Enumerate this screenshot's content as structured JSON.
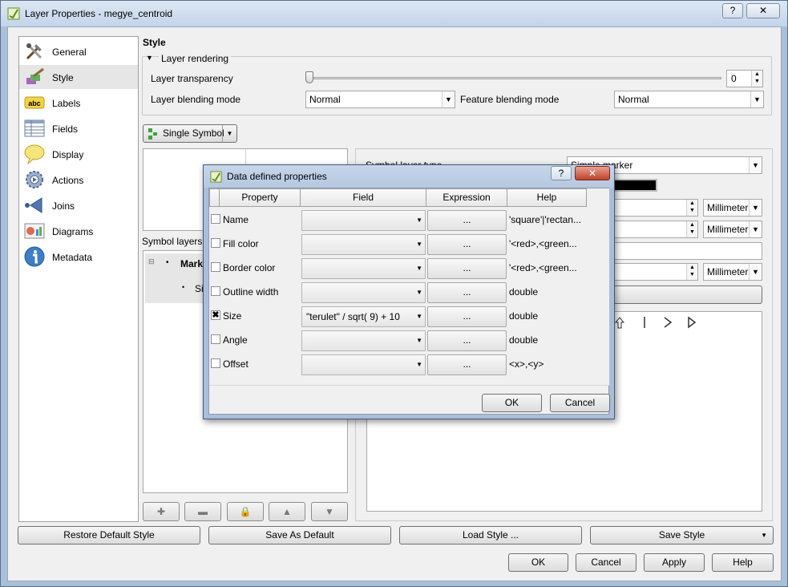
{
  "window": {
    "title": "Layer Properties - megye_centroid",
    "help_btn": "?",
    "close_btn": "✕"
  },
  "nav": {
    "items": [
      {
        "label": "General",
        "icon": "tools-icon"
      },
      {
        "label": "Style",
        "icon": "brush-icon"
      },
      {
        "label": "Labels",
        "icon": "abc-label-icon"
      },
      {
        "label": "Fields",
        "icon": "table-icon"
      },
      {
        "label": "Display",
        "icon": "speech-bubble-icon"
      },
      {
        "label": "Actions",
        "icon": "gear-icon"
      },
      {
        "label": "Joins",
        "icon": "join-arrow-icon"
      },
      {
        "label": "Diagrams",
        "icon": "diagram-icon"
      },
      {
        "label": "Metadata",
        "icon": "info-icon"
      }
    ],
    "selected": "Style"
  },
  "style": {
    "heading": "Style",
    "layer_rendering": "Layer rendering",
    "transparency_label": "Layer transparency",
    "transparency_value": "0",
    "layer_blending_label": "Layer blending mode",
    "layer_blending_value": "Normal",
    "feature_blending_label": "Feature blending mode",
    "feature_blending_value": "Normal",
    "renderer_button": "Single Symbol",
    "symbol_layers_label": "Symbol layers",
    "tree_marker": "Mark",
    "tree_sub": "Si",
    "symbol_layer_type_label": "Symbol layer type",
    "symbol_layer_type_value": "Simple marker",
    "units": [
      "Millimeter",
      "Millimeter",
      "Millimeter"
    ]
  },
  "bottom": {
    "restore": "Restore Default Style",
    "save_default": "Save As Default",
    "load": "Load Style ...",
    "save": "Save Style",
    "ok": "OK",
    "cancel": "Cancel",
    "apply": "Apply",
    "help": "Help"
  },
  "dialog": {
    "title": "Data defined properties",
    "help_btn": "?",
    "close_btn": "✕",
    "headers": {
      "property": "Property",
      "field": "Field",
      "expression": "Expression",
      "help": "Help"
    },
    "rows": [
      {
        "checked": "",
        "name": "Name",
        "field": "",
        "expr": "...",
        "help": "'square'|'rectan..."
      },
      {
        "checked": "",
        "name": "Fill color",
        "field": "",
        "expr": "...",
        "help": "'<red>,<green..."
      },
      {
        "checked": "",
        "name": "Border color",
        "field": "",
        "expr": "...",
        "help": "'<red>,<green..."
      },
      {
        "checked": "",
        "name": "Outline width",
        "field": "",
        "expr": "...",
        "help": "double"
      },
      {
        "checked": "✖",
        "name": "Size",
        "field": "\"terulet\"  /  sqrt( 9) + 10",
        "expr": "...",
        "help": "double"
      },
      {
        "checked": "",
        "name": "Angle",
        "field": "",
        "expr": "...",
        "help": "double"
      },
      {
        "checked": "",
        "name": "Offset",
        "field": "",
        "expr": "...",
        "help": "<x>,<y>"
      }
    ],
    "ok": "OK",
    "cancel": "Cancel"
  },
  "colors": {
    "accent": "#3c6fb4",
    "dialog_frame": "#a9bed9",
    "color_swatch": "#000000"
  }
}
